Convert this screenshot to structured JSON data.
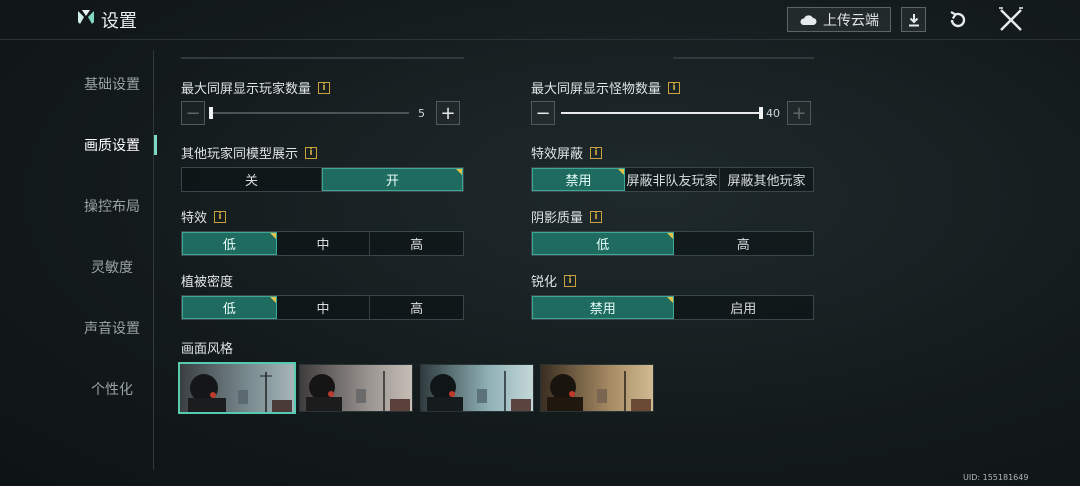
{
  "header": {
    "title": "设置",
    "upload_label": "上传云端"
  },
  "sidebar": {
    "items": [
      {
        "label": "基础设置",
        "active": false
      },
      {
        "label": "画质设置",
        "active": true
      },
      {
        "label": "操控布局",
        "active": false
      },
      {
        "label": "灵敏度",
        "active": false
      },
      {
        "label": "声音设置",
        "active": false
      },
      {
        "label": "个性化",
        "active": false
      }
    ]
  },
  "settings": {
    "max_players": {
      "label": "最大同屏显示玩家数量",
      "value": "5",
      "level": 0.0
    },
    "max_monsters": {
      "label": "最大同屏显示怪物数量",
      "value": "40",
      "level": 1.0
    },
    "same_model": {
      "label": "其他玩家同模型展示",
      "options": [
        "关",
        "开"
      ],
      "selected": 1
    },
    "effect_mask": {
      "label": "特效屏蔽",
      "options": [
        "禁用",
        "屏蔽非队友玩家",
        "屏蔽其他玩家"
      ],
      "selected": 0
    },
    "effects": {
      "label": "特效",
      "options": [
        "低",
        "中",
        "高"
      ],
      "selected": 0
    },
    "shadow": {
      "label": "阴影质量",
      "options": [
        "低",
        "高"
      ],
      "selected": 0
    },
    "vegetation": {
      "label": "植被密度",
      "options": [
        "低",
        "中",
        "高"
      ],
      "selected": 0
    },
    "sharpen": {
      "label": "锐化",
      "options": [
        "禁用",
        "启用"
      ],
      "selected": 0
    },
    "style": {
      "label": "画面风格",
      "selected": 0
    }
  },
  "info_glyph": "i",
  "footer": {
    "uid": "UID: 155181649"
  },
  "colors": {
    "accent": "#1f6b60",
    "accent_border": "#3fa796",
    "corner": "#e1c24b",
    "info": "#d6b04a"
  }
}
